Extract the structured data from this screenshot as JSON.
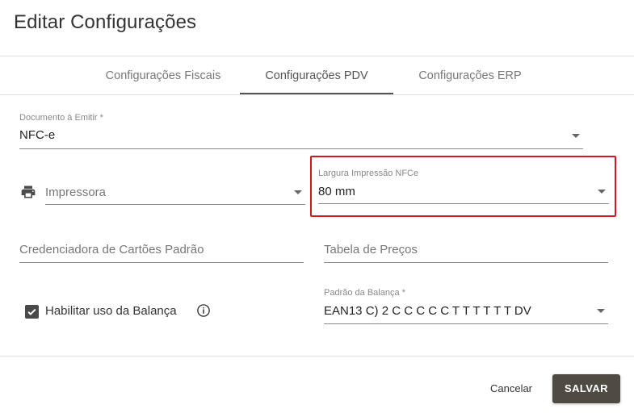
{
  "dialog": {
    "title": "Editar Configurações"
  },
  "tabs": [
    {
      "label": "Configurações Fiscais",
      "active": false
    },
    {
      "label": "Configurações PDV",
      "active": true
    },
    {
      "label": "Configurações ERP",
      "active": false
    }
  ],
  "form": {
    "documento": {
      "label": "Documento à Emitir *",
      "value": "NFC-e"
    },
    "impressora": {
      "placeholder": "Impressora",
      "icon": "printer-icon"
    },
    "largura": {
      "label": "Largura Impressão NFCe",
      "value": "80 mm"
    },
    "credenciadora": {
      "placeholder": "Credenciadora de Cartões Padrão"
    },
    "tabela_precos": {
      "placeholder": "Tabela de Preços"
    },
    "balanca": {
      "label": "Habilitar uso da Balança",
      "checked": true,
      "info_icon": "info-icon"
    },
    "padrao_balanca": {
      "label": "Padrão da Balança *",
      "value": "EAN13 C) 2 C C C C C T T T T T T DV"
    }
  },
  "actions": {
    "cancel_label": "Cancelar",
    "save_label": "SALVAR"
  },
  "colors": {
    "highlight": "#d0181f",
    "save_button": "#4f4b43",
    "tab_indicator": "#555555"
  }
}
